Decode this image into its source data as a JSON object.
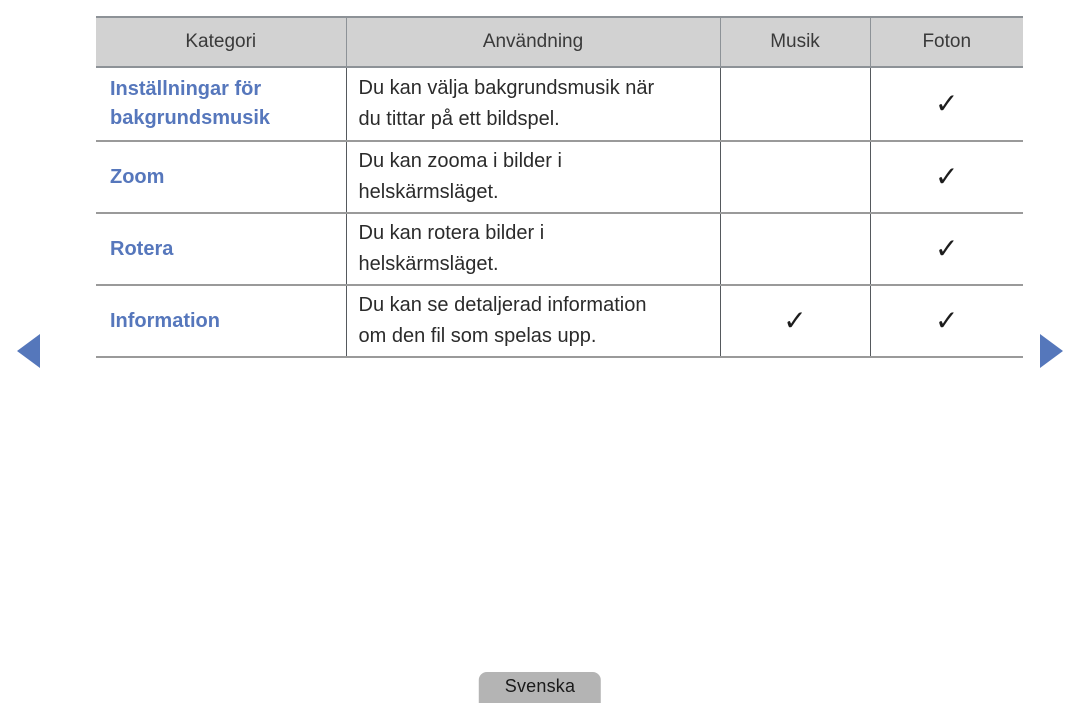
{
  "table": {
    "columns": [
      "Kategori",
      "Användning",
      "Musik",
      "Foton"
    ],
    "rows": [
      {
        "category": "Inställningar för bakgrundsmusik",
        "category_line1": "Inställningar för",
        "category_line2": "bakgrundsmusik",
        "usage_line1": "Du kan välja bakgrundsmusik när",
        "usage_line2": "du tittar på ett bildspel.",
        "musik": "",
        "foton": "✓"
      },
      {
        "category": "Zoom",
        "category_line1": "Zoom",
        "category_line2": "",
        "usage_line1": "Du kan zooma i bilder i",
        "usage_line2": "helskärmsläget.",
        "musik": "",
        "foton": "✓"
      },
      {
        "category": "Rotera",
        "category_line1": "Rotera",
        "category_line2": "",
        "usage_line1": "Du kan rotera bilder i",
        "usage_line2": "helskärmsläget.",
        "musik": "",
        "foton": "✓"
      },
      {
        "category": "Information",
        "category_line1": "Information",
        "category_line2": "",
        "usage_line1": "Du kan se detaljerad information",
        "usage_line2": "om den fil som spelas upp.",
        "musik": "✓",
        "foton": "✓"
      }
    ]
  },
  "navigation": {
    "previous_icon": "triangle-left-icon",
    "next_icon": "triangle-right-icon"
  },
  "footer": {
    "language": "Svenska"
  },
  "colors": {
    "category_blue": "#5677bc",
    "arrow_blue": "#5577bb",
    "header_gray": "#d2d2d2",
    "badge_gray": "#b4b4b4",
    "border_gray": "#8d9297",
    "text_dark": "#2b2b2b"
  }
}
